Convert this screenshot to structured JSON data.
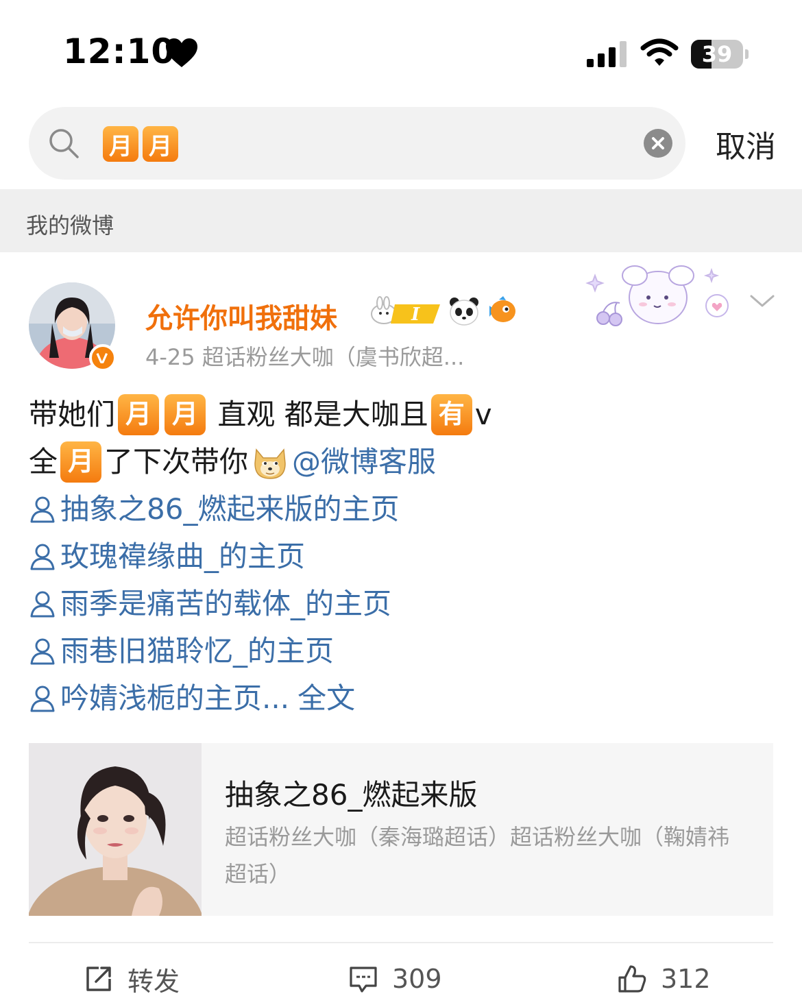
{
  "status_bar": {
    "time": "12:10",
    "battery": "39",
    "battery_level": 0.39
  },
  "search": {
    "keycaps": [
      "月",
      "月"
    ],
    "cancel_label": "取消"
  },
  "section": {
    "label": "我的微博"
  },
  "post": {
    "user_name": "允许你叫我甜妹",
    "level_badge": "I",
    "meta": "4-25  超话粉丝大咖（虞书欣超...",
    "body": {
      "l1_a": "带她们",
      "l1_k1": "月",
      "l1_k2": "月",
      "l1_b": " 直观 都是大咖且",
      "l1_k3": "有",
      "l1_c": "v",
      "l2_a": "全",
      "l2_k1": "月",
      "l2_b": "了下次带你",
      "l2_mention": "@微博客服",
      "links": [
        "抽象之86_燃起来版的主页",
        "玫瑰禕缘曲_的主页",
        "雨季是痛苦的载体_的主页",
        "雨巷旧猫聆忆_的主页",
        "吟婧浅栀的主页..."
      ],
      "full_text": "全文"
    },
    "card": {
      "title": "抽象之86_燃起来版",
      "desc": "超话粉丝大咖（秦海璐超话）超话粉丝大咖（鞠婧祎超话）"
    },
    "actions": {
      "repost_label": "转发",
      "comments": "309",
      "likes": "312"
    }
  },
  "colors": {
    "accent": "#f0700c",
    "link": "#3b6ea8",
    "keycap": "#f47b0f"
  },
  "icons": [
    "heart-icon",
    "signal-icon",
    "wifi-icon",
    "search-icon",
    "clear-icon",
    "person-icon",
    "doge-emoji-icon",
    "panda-icon",
    "fish-icon",
    "chevron-down-icon",
    "repost-icon",
    "comment-icon",
    "like-icon"
  ]
}
